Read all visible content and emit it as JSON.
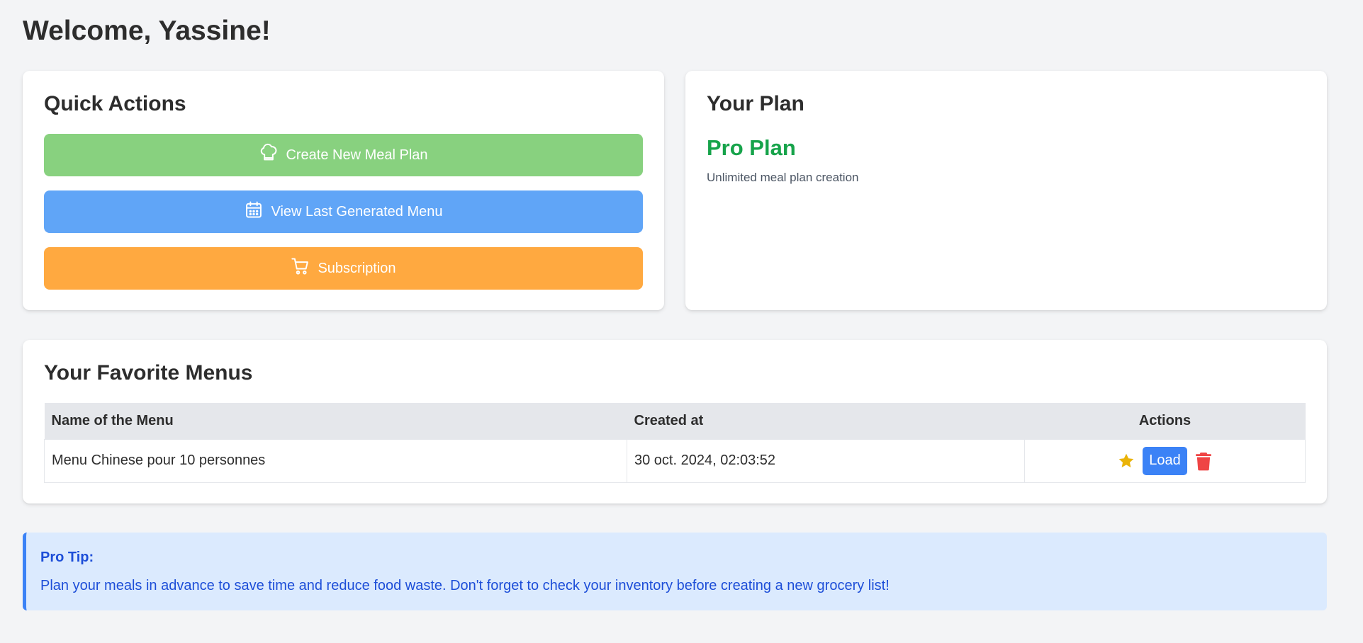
{
  "header": {
    "title": "Welcome, Yassine!"
  },
  "quick_actions": {
    "title": "Quick Actions",
    "buttons": [
      {
        "label": "Create New Meal Plan",
        "icon": "chef-hat-icon",
        "color": "#88d17f"
      },
      {
        "label": "View Last Generated Menu",
        "icon": "calendar-icon",
        "color": "#60a5f7"
      },
      {
        "label": "Subscription",
        "icon": "cart-icon",
        "color": "#ffa940"
      }
    ]
  },
  "plan": {
    "title": "Your Plan",
    "name": "Pro Plan",
    "description": "Unlimited meal plan creation",
    "name_color": "#16a34a"
  },
  "favorites": {
    "title": "Your Favorite Menus",
    "columns": [
      "Name of the Menu",
      "Created at",
      "Actions"
    ],
    "rows": [
      {
        "name": "Menu Chinese pour 10 personnes",
        "created_at": "30 oct. 2024, 02:03:52",
        "load_label": "Load"
      }
    ]
  },
  "tip": {
    "title": "Pro Tip:",
    "text": "Plan your meals in advance to save time and reduce food waste. Don't forget to check your inventory before creating a new grocery list!"
  }
}
